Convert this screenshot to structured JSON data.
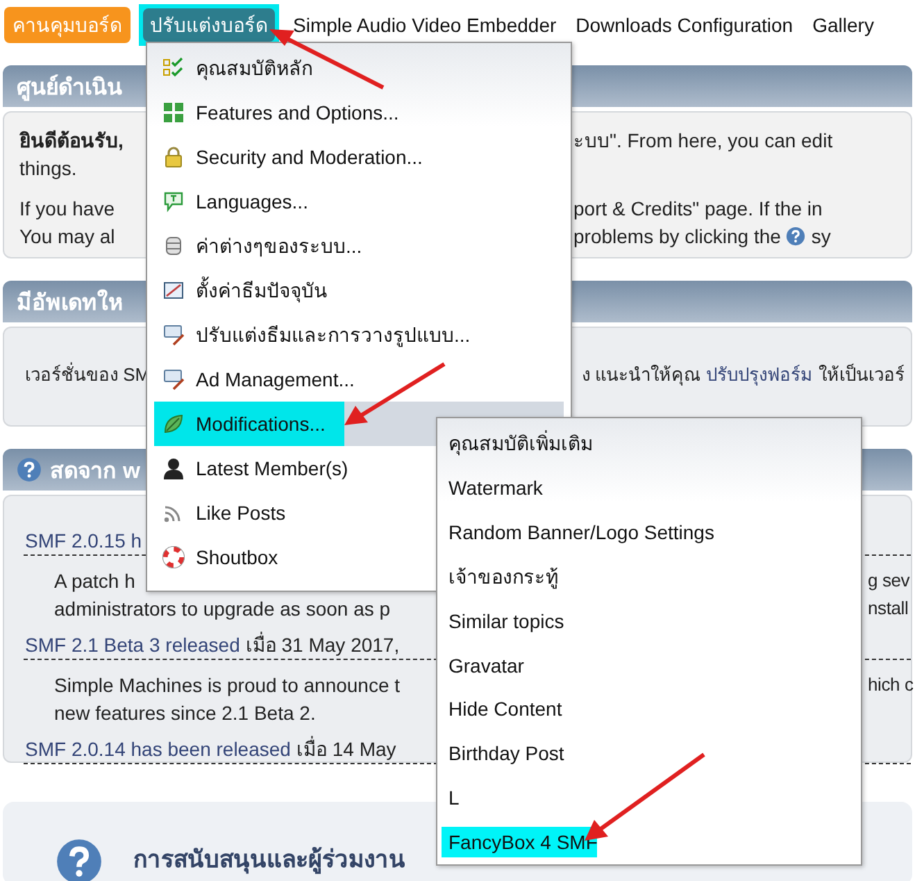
{
  "nav": [
    {
      "label": "คานคุมบอร์ด",
      "active": true,
      "highlighted": false
    },
    {
      "label": "ปรับแต่งบอร์ด",
      "active": false,
      "highlighted": true
    },
    {
      "label": "Simple Audio Video Embedder",
      "active": false,
      "highlighted": false
    },
    {
      "label": "Downloads Configuration",
      "active": false,
      "highlighted": false
    },
    {
      "label": "Gallery",
      "active": false,
      "highlighted": false
    }
  ],
  "welcome_panel": {
    "title": "ศูนย์ดำเนิน",
    "lines": [
      {
        "left": [
          {
            "kind": "bold",
            "text": "ยินดีต้อนรับ,"
          }
        ],
        "right": [
          {
            "kind": "text",
            "text": "ะบบ\". From here, you can edit"
          }
        ]
      },
      {
        "left": [
          {
            "kind": "text",
            "text": "things."
          }
        ]
      },
      {
        "left": [
          {
            "kind": "text",
            "text": "If you have"
          }
        ],
        "right": [
          {
            "kind": "text",
            "text": "port & Credits\" page. If the in"
          }
        ]
      },
      {
        "left": [
          {
            "kind": "text",
            "text": "You may al"
          }
        ],
        "right": [
          {
            "kind": "text",
            "text": "problems by clicking the"
          },
          {
            "kind": "help"
          },
          {
            "kind": "text",
            "text": "sy"
          }
        ]
      }
    ]
  },
  "update_panel": {
    "title": "มีอัพเดทให",
    "lines": [
      {
        "left": [
          {
            "kind": "text",
            "text": "เวอร์ชั่นของ SM"
          }
        ],
        "right": [
          {
            "kind": "text",
            "text": "ง แนะนำให้คุณ"
          },
          {
            "kind": "link",
            "text": "ปรับปรุงฟอร์ม"
          },
          {
            "kind": "text",
            "text": "ให้เป็นเวอร์"
          }
        ]
      }
    ]
  },
  "news_panel": {
    "title": "สดจาก w",
    "lines": [
      {
        "kind": "headline",
        "left": [
          {
            "kind": "link",
            "text": "SMF 2.0.15 h"
          }
        ]
      },
      {
        "kind": "body",
        "left": [
          {
            "kind": "text",
            "text": "A patch h"
          }
        ],
        "right": [
          {
            "kind": "text",
            "text": "g sev"
          }
        ]
      },
      {
        "kind": "body",
        "left": [
          {
            "kind": "text",
            "text": "administrators to upgrade as soon as p"
          }
        ],
        "right": [
          {
            "kind": "text",
            "text": "nstall"
          }
        ]
      },
      {
        "kind": "headline",
        "left": [
          {
            "kind": "link",
            "text": "SMF 2.1 Beta 3 released"
          },
          {
            "kind": "text",
            "text": "เมื่อ 31 May 2017,"
          }
        ]
      },
      {
        "kind": "body",
        "left": [
          {
            "kind": "text",
            "text": "Simple Machines is proud to announce t"
          }
        ],
        "right": [
          {
            "kind": "text",
            "text": "hich c"
          }
        ]
      },
      {
        "kind": "body",
        "left": [
          {
            "kind": "text",
            "text": "new features since 2.1 Beta 2."
          }
        ]
      },
      {
        "kind": "headline",
        "left": [
          {
            "kind": "link",
            "text": "SMF 2.0.14 has been released"
          },
          {
            "kind": "text",
            "text": "เมื่อ 14 May"
          }
        ]
      }
    ]
  },
  "support_panel": {
    "title": "การสนับสนุนและผู้ร่วมงาน"
  },
  "admin_menu": {
    "items": [
      {
        "label": "คุณสมบัติหลัก",
        "selected": false
      },
      {
        "label": "Features and Options...",
        "selected": false
      },
      {
        "label": "Security and Moderation...",
        "selected": false
      },
      {
        "label": "Languages...",
        "selected": false
      },
      {
        "label": "ค่าต่างๆของระบบ...",
        "selected": false
      },
      {
        "label": "ตั้งค่าธีมปัจจุบัน",
        "selected": false
      },
      {
        "label": "ปรับแต่งธีมและการวางรูปแบบ...",
        "selected": false
      },
      {
        "label": "Ad Management...",
        "selected": false
      },
      {
        "label": "Modifications...",
        "selected": true
      },
      {
        "label": "Latest Member(s)",
        "selected": false
      },
      {
        "label": "Like Posts",
        "selected": false
      },
      {
        "label": "Shoutbox",
        "selected": false
      }
    ]
  },
  "submenu": {
    "items": [
      {
        "label": "คุณสมบัติเพิ่มเติม",
        "selected": false
      },
      {
        "label": "Watermark",
        "selected": false
      },
      {
        "label": "Random Banner/Logo Settings",
        "selected": false
      },
      {
        "label": "เจ้าของกระทู้",
        "selected": false
      },
      {
        "label": "Similar topics",
        "selected": false
      },
      {
        "label": "Gravatar",
        "selected": false
      },
      {
        "label": "Hide Content",
        "selected": false
      },
      {
        "label": "Birthday Post",
        "selected": false
      },
      {
        "label": "L",
        "selected": false
      },
      {
        "label": "FancyBox 4 SMF",
        "selected": true
      }
    ]
  }
}
